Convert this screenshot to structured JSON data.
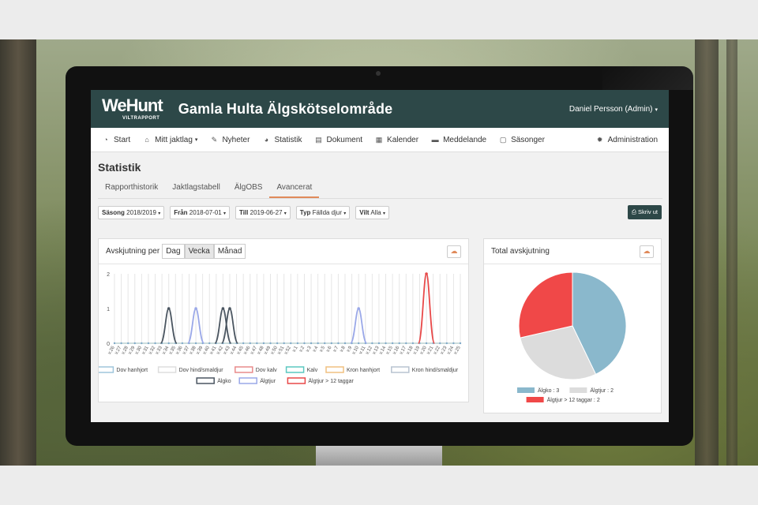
{
  "header": {
    "logo_main": "WeHunt",
    "logo_sub": "VILTRAPPORT",
    "title": "Gamla Hulta Älgskötselområde",
    "user": "Daniel Persson (Admin)"
  },
  "nav": {
    "start": "Start",
    "mitt_jaktlag": "Mitt jaktlag",
    "nyheter": "Nyheter",
    "statistik": "Statistik",
    "dokument": "Dokument",
    "kalender": "Kalender",
    "meddelande": "Meddelande",
    "sasonger": "Säsonger",
    "administration": "Administration"
  },
  "page_title": "Statistik",
  "tabs": [
    "Rapporthistorik",
    "Jaktlagstabell",
    "ÄlgOBS",
    "Avancerat"
  ],
  "active_tab": "Avancerat",
  "filters": [
    {
      "label": "Säsong",
      "value": "2018/2019"
    },
    {
      "label": "Från",
      "value": "2018-07-01"
    },
    {
      "label": "Till",
      "value": "2019-06-27"
    },
    {
      "label": "Typ",
      "value": "Fällda djur"
    },
    {
      "label": "Vilt",
      "value": "Alla"
    }
  ],
  "print_label": "Skriv ut",
  "left_panel": {
    "label": "Avskjutning per",
    "segments": [
      "Dag",
      "Vecka",
      "Månad"
    ],
    "selected_segment": "Vecka"
  },
  "right_panel": {
    "title": "Total avskjutning"
  },
  "chart_data": [
    {
      "type": "line",
      "ylim": [
        0,
        2
      ],
      "yticks": [
        "0",
        "1",
        "2"
      ],
      "categories": [
        "v.26",
        "v.27",
        "v.28",
        "v.29",
        "v.30",
        "v.31",
        "v.32",
        "v.33",
        "v.34",
        "v.35",
        "v.36",
        "v.37",
        "v.38",
        "v.39",
        "v.40",
        "v.41",
        "v.42",
        "v.43",
        "v.44",
        "v.45",
        "v.46",
        "v.47",
        "v.48",
        "v.49",
        "v.50",
        "v.51",
        "v.52",
        "v.1",
        "v.2",
        "v.3",
        "v.4",
        "v.5",
        "v.6",
        "v.7",
        "v.8",
        "v.9",
        "v.10",
        "v.11",
        "v.12",
        "v.13",
        "v.14",
        "v.15",
        "v.16",
        "v.17",
        "v.18",
        "v.19",
        "v.20",
        "v.21",
        "v.22",
        "v.23",
        "v.24",
        "v.25"
      ],
      "series": [
        {
          "name": "Dov hanhjort",
          "color": "#9fc6dc",
          "values": []
        },
        {
          "name": "Dov hind/smaldjur",
          "color": "#dddddd",
          "values": []
        },
        {
          "name": "Dov kalv",
          "color": "#e98b8b",
          "values": []
        },
        {
          "name": "Kalv",
          "color": "#5bc8c0",
          "values": []
        },
        {
          "name": "Kron hanhjort",
          "color": "#f0c080",
          "values": []
        },
        {
          "name": "Kron hind/smaldjur",
          "color": "#b8c4d0",
          "values": []
        },
        {
          "name": "Älgko",
          "color": "#4a5560",
          "values": [
            {
              "x": "v.34",
              "y": 1
            },
            {
              "x": "v.42",
              "y": 1
            },
            {
              "x": "v.43",
              "y": 1
            }
          ]
        },
        {
          "name": "Älgtjur",
          "color": "#9aa8e8",
          "values": [
            {
              "x": "v.38",
              "y": 1
            },
            {
              "x": "v.10",
              "y": 1
            }
          ]
        },
        {
          "name": "Älgtjur > 12 taggar",
          "color": "#e84848",
          "values": [
            {
              "x": "v.20",
              "y": 2
            }
          ]
        }
      ]
    },
    {
      "type": "pie",
      "slices": [
        {
          "label": "Älgko",
          "value": 3,
          "color": "#8ab8cc"
        },
        {
          "label": "Älgtjur",
          "value": 2,
          "color": "#dcdcdc"
        },
        {
          "label": "Älgtjur > 12 taggar",
          "value": 2,
          "color": "#f04848"
        }
      ]
    }
  ]
}
